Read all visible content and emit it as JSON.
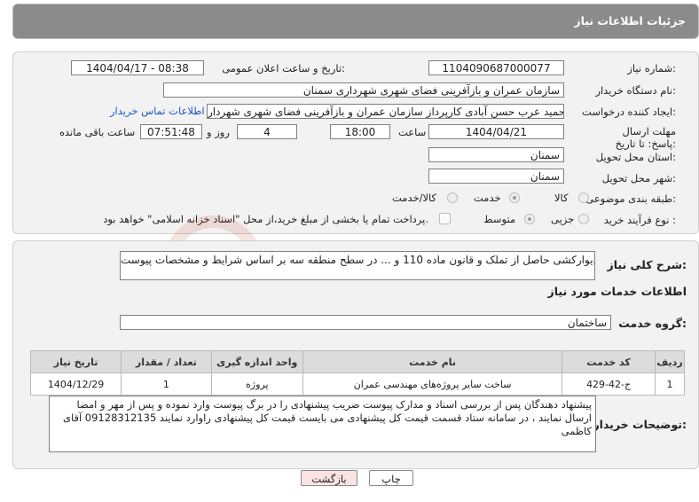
{
  "header": {
    "title": "جزئیات اطلاعات نیاز"
  },
  "form": {
    "need_number_label": "شماره نیاز:",
    "need_number": "1104090687000077",
    "announce_label": "تاریخ و ساعت اعلان عمومی:",
    "announce_value": "1404/04/17 - 08:38",
    "buyer_org_label": "نام دستگاه خریدار:",
    "buyer_org": "سازمان عمران و بازآفرینی فضای شهری شهرداری سمنان",
    "requester_label": "ایجاد کننده درخواست:",
    "requester": "حمید عرب حسن آبادی کارپرداز سازمان عمران و بازآفرینی فضای شهری شهردار",
    "contact_link": "اطلاعات تماس خریدار",
    "deadline_label": "مهلت ارسال پاسخ: تا تاریخ:",
    "deadline_date": "1404/04/21",
    "time_label": "ساعت",
    "deadline_time": "18:00",
    "days": "4",
    "days_label": "روز و",
    "remaining_time": "07:51:48",
    "remaining_label": "ساعت باقی مانده",
    "province_label": "استان محل تحویل:",
    "province": "سمنان",
    "city_label": "شهر محل تحویل:",
    "city": "سمنان",
    "category_label": "طبقه بندی موضوعی:",
    "category_options": [
      "کالا",
      "خدمت",
      "کالا/خدمت"
    ],
    "category_selected": "خدمت",
    "process_label": "نوع فرآیند خرید :",
    "process_options": [
      "جزیی",
      "متوسط"
    ],
    "process_selected": "متوسط",
    "payment_note": "پرداخت تمام یا بخشی از مبلغ خرید،از محل \"اسناد خزانه اسلامی\" خواهد بود."
  },
  "summary": {
    "label": "شرح کلی نیاز:",
    "text": "دیوارکشی حاصل از تملک و قانون ماده 110 و ... در سطح منطقه سه بر اساس شرایط و مشخصات پیوست"
  },
  "services": {
    "section_title": "اطلاعات خدمات مورد نیاز",
    "group_label": "گروه خدمت:",
    "group_value": "ساختمان",
    "columns": [
      "ردیف",
      "کد خدمت",
      "نام خدمت",
      "واحد اندازه گیری",
      "تعداد / مقدار",
      "تاریخ نیاز"
    ],
    "rows": [
      [
        "1",
        "ج-42-429",
        "ساخت سایر پروژه‌های مهندسی عمران",
        "پروژه",
        "1",
        "1404/12/29"
      ]
    ]
  },
  "notes": {
    "label": "توضیحات خریدار:",
    "text": "پیشنهاد دهندگان پس از بررسی اسناد و مدارک پیوست ضریب پیشنهادی را در برگ پیوست وارد نموده و پس از مهر و امضا ارسال نمایند ، در سامانه ستاد قسمت قیمت کل پیشنهادی می بایست قیمت کل پیشنهادی راوارد نمایند 09128312135 آقای کاظمی"
  },
  "buttons": {
    "print": "چاپ",
    "back": "بازگشت"
  },
  "colors": {
    "header_bg": "#8b8b8b",
    "panel_bg": "#f2f2f2",
    "link": "#1a56c9",
    "back_btn": "#fbe3e3"
  }
}
